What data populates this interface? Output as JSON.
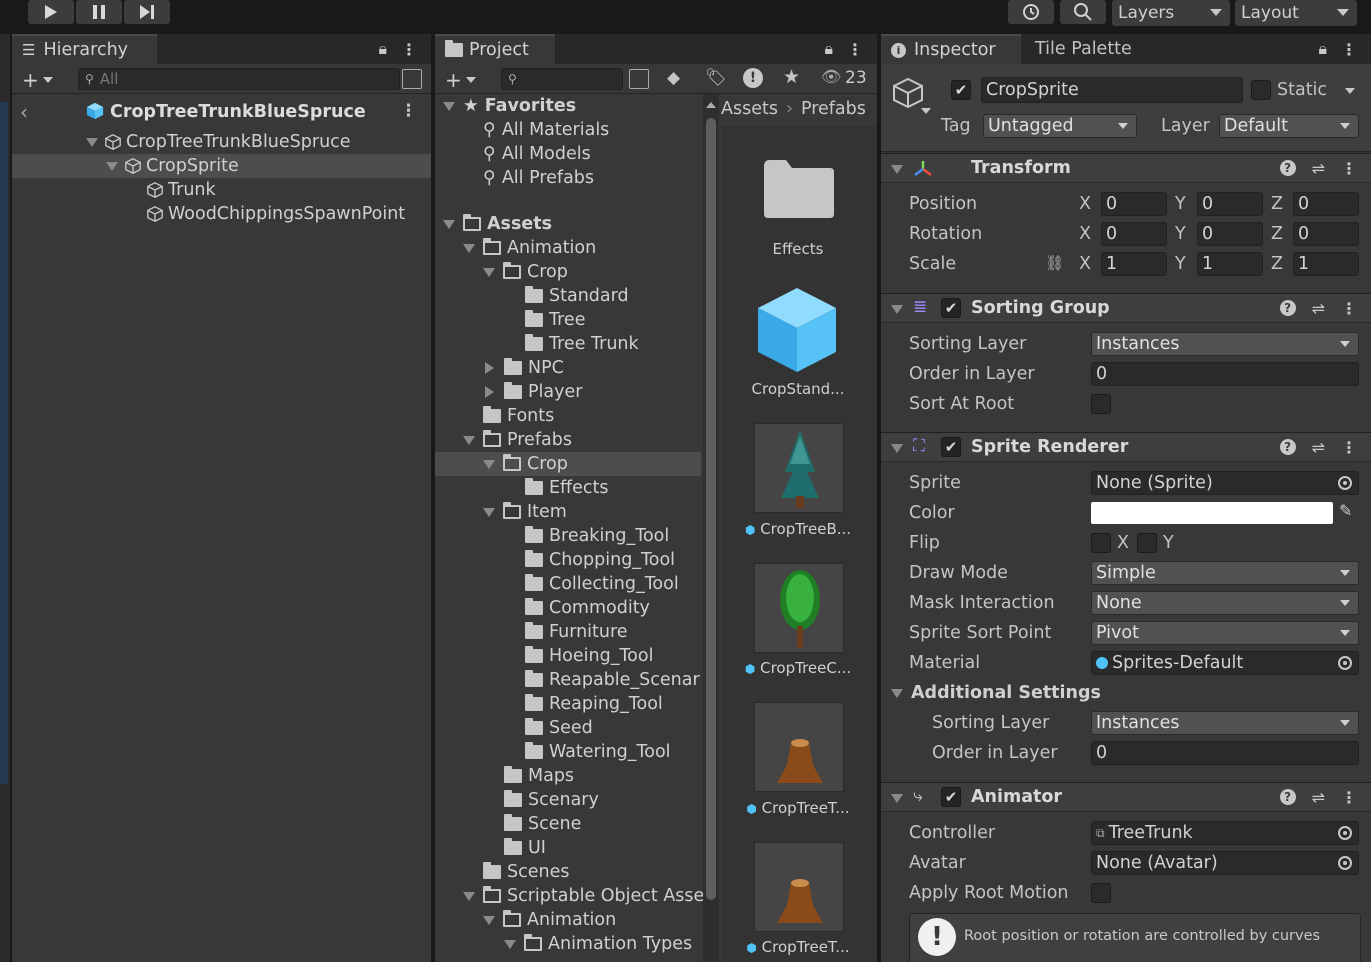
{
  "toolbar": {
    "play_icon": "play-icon",
    "pause_icon": "pause-icon",
    "step_icon": "step-icon",
    "history_icon": "history-icon",
    "search_icon": "search-icon",
    "layers_label": "Layers",
    "layout_label": "Layout"
  },
  "hierarchy": {
    "tab_label": "Hierarchy",
    "search_placeholder": "All",
    "scene_title": "CropTreeTrunkBlueSpruce",
    "items": [
      {
        "label": "CropTreeTrunkBlueSpruce"
      },
      {
        "label": "CropSprite"
      },
      {
        "label": "Trunk"
      },
      {
        "label": "WoodChippingsSpawnPoint"
      }
    ]
  },
  "project": {
    "tab_label": "Project",
    "hidden_count": "23",
    "favorites_label": "Favorites",
    "favorites": [
      "All Materials",
      "All Models",
      "All Prefabs"
    ],
    "assets_label": "Assets",
    "tree": [
      "Animation",
      "Crop",
      "Standard",
      "Tree",
      "Tree Trunk",
      "NPC",
      "Player",
      "Fonts",
      "Prefabs",
      "Crop",
      "Effects",
      "Item",
      "Breaking_Tool",
      "Chopping_Tool",
      "Collecting_Tool",
      "Commodity",
      "Furniture",
      "Hoeing_Tool",
      "Reapable_Scenar",
      "Reaping_Tool",
      "Seed",
      "Watering_Tool",
      "Maps",
      "Scenary",
      "Scene",
      "UI",
      "Scenes",
      "Scriptable Object Asse",
      "Animation",
      "Animation Types"
    ],
    "breadcrumb": [
      "Assets",
      "Prefabs"
    ],
    "grid": [
      {
        "label": "Effects"
      },
      {
        "label": "CropStand..."
      },
      {
        "label": "CropTreeB..."
      },
      {
        "label": "CropTreeC..."
      },
      {
        "label": "CropTreeT..."
      },
      {
        "label": "CropTreeT..."
      }
    ]
  },
  "inspector": {
    "tab_label": "Inspector",
    "tab2_label": "Tile Palette",
    "object_name": "CropSprite",
    "static_label": "Static",
    "tag_label": "Tag",
    "tag_value": "Untagged",
    "layer_label": "Layer",
    "layer_value": "Default",
    "transform": {
      "title": "Transform",
      "rows": [
        {
          "label": "Position",
          "x": "0",
          "y": "0",
          "z": "0"
        },
        {
          "label": "Rotation",
          "x": "0",
          "y": "0",
          "z": "0"
        },
        {
          "label": "Scale",
          "x": "1",
          "y": "1",
          "z": "1"
        }
      ],
      "axis": [
        "X",
        "Y",
        "Z"
      ]
    },
    "sorting_group": {
      "title": "Sorting Group",
      "sorting_layer_label": "Sorting Layer",
      "sorting_layer_value": "Instances",
      "order_label": "Order in Layer",
      "order_value": "0",
      "sort_at_root_label": "Sort At Root"
    },
    "sprite_renderer": {
      "title": "Sprite Renderer",
      "sprite_label": "Sprite",
      "sprite_value": "None (Sprite)",
      "color_label": "Color",
      "color_value": "#ffffff",
      "flip_label": "Flip",
      "flip_x": "X",
      "flip_y": "Y",
      "draw_mode_label": "Draw Mode",
      "draw_mode_value": "Simple",
      "mask_label": "Mask Interaction",
      "mask_value": "None",
      "sort_point_label": "Sprite Sort Point",
      "sort_point_value": "Pivot",
      "material_label": "Material",
      "material_value": "Sprites-Default",
      "additional_label": "Additional Settings",
      "add_sorting_layer_label": "Sorting Layer",
      "add_sorting_layer_value": "Instances",
      "add_order_label": "Order in Layer",
      "add_order_value": "0"
    },
    "animator": {
      "title": "Animator",
      "controller_label": "Controller",
      "controller_value": "TreeTrunk",
      "avatar_label": "Avatar",
      "avatar_value": "None (Avatar)",
      "root_motion_label": "Apply Root Motion",
      "info_text": "Root position or rotation are controlled by curves"
    }
  },
  "colors": {
    "panel_bg": "#383838",
    "accent_blue": "#4fc3f7",
    "selected_row": "#4d4d4d"
  }
}
